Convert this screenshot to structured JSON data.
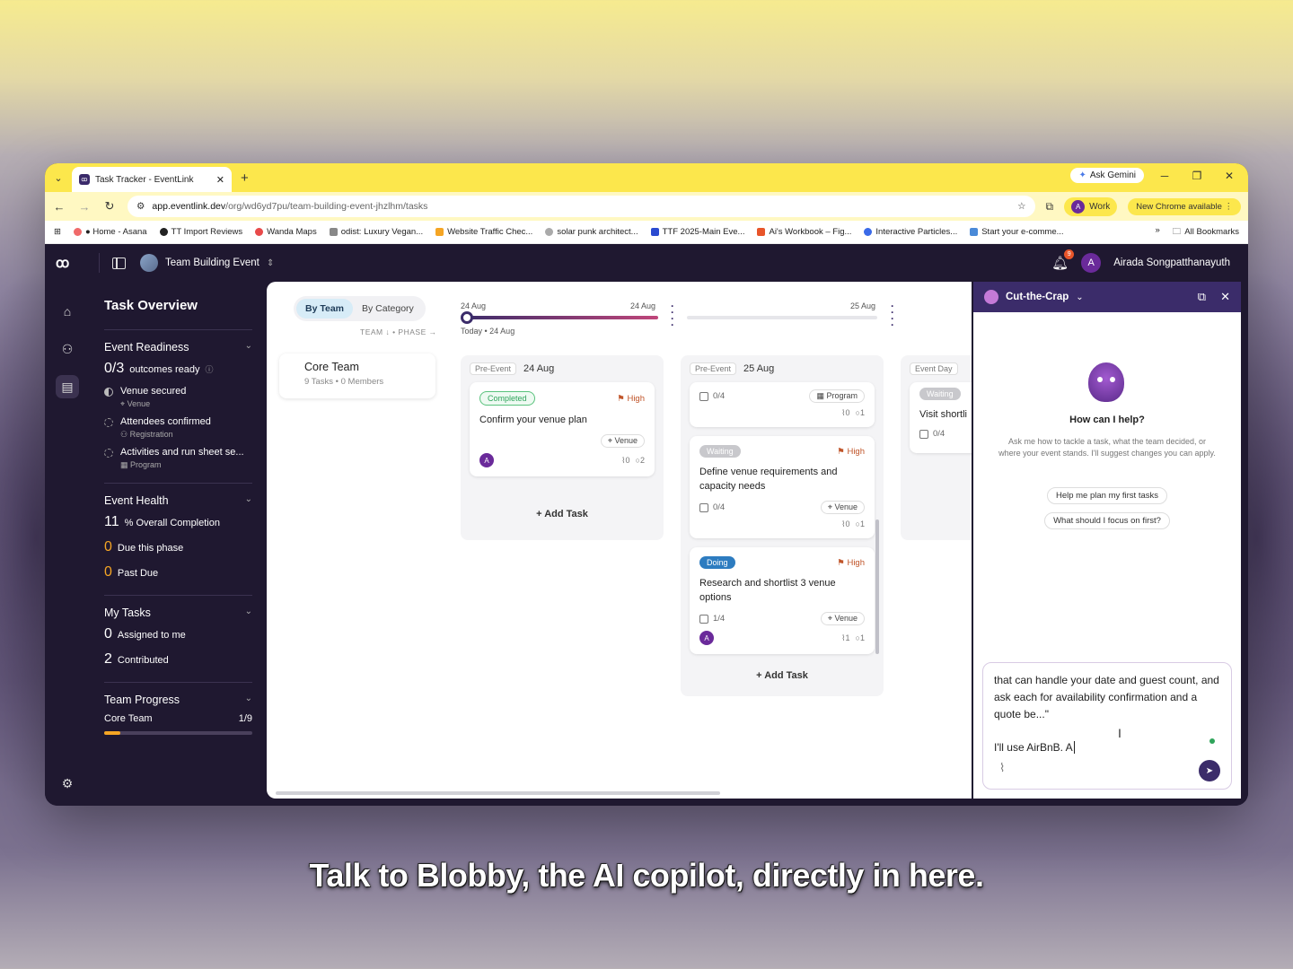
{
  "browser": {
    "tab_title": "Task Tracker - EventLink",
    "ask_gemini": "Ask Gemini",
    "url_host": "app.eventlink.dev",
    "url_path": "/org/wd6yd7pu/team-building-event-jhzlhm/tasks",
    "profile_label": "Work",
    "profile_initial": "A",
    "new_chrome": "New Chrome available",
    "bookmarks": [
      "● Home - Asana",
      "TT Import Reviews",
      "Wanda Maps",
      "odist: Luxury Vegan...",
      "Website Traffic Chec...",
      "solar punk architect...",
      "TTF 2025-Main Eve...",
      "Ai's Workbook – Fig...",
      "Interactive Particles...",
      "Start your e-comme..."
    ],
    "all_bookmarks": "All Bookmarks"
  },
  "app": {
    "project": "Team Building Event",
    "notification_count": "9",
    "user_initial": "A",
    "user_name": "Airada Songpatthanayuth"
  },
  "sidebar": {
    "title": "Task Overview",
    "readiness": {
      "heading": "Event Readiness",
      "count": "0/3",
      "count_label": "outcomes ready",
      "outcomes": [
        {
          "title": "Venue secured",
          "sub": "Venue"
        },
        {
          "title": "Attendees confirmed",
          "sub": "Registration"
        },
        {
          "title": "Activities and run sheet se...",
          "sub": "Program"
        }
      ]
    },
    "health": {
      "heading": "Event Health",
      "completion_value": "11",
      "completion_label": "% Overall Completion",
      "due_value": "0",
      "due_label": "Due this phase",
      "past_value": "0",
      "past_label": "Past Due"
    },
    "my_tasks": {
      "heading": "My Tasks",
      "assigned_value": "0",
      "assigned_label": "Assigned to me",
      "contributed_value": "2",
      "contributed_label": "Contributed"
    },
    "team_progress": {
      "heading": "Team Progress",
      "team": "Core Team",
      "value": "1/9",
      "fraction": 0.11
    }
  },
  "board": {
    "toggle": [
      "By Team",
      "By Category"
    ],
    "team_phase": "TEAM ↓ • PHASE →",
    "timeline": {
      "start": "24 Aug",
      "end": "24 Aug",
      "today": "Today • 24 Aug",
      "next": "25 Aug"
    },
    "team": {
      "name": "Core Team",
      "meta": "9 Tasks • 0 Members"
    },
    "columns": [
      {
        "phase": "Pre-Event",
        "date": "24 Aug",
        "add": "Add Task",
        "cards": [
          {
            "status": "Completed",
            "priority": "High",
            "title": "Confirm your venue plan",
            "tag": "Venue",
            "avatar": "A",
            "attachments": "0",
            "comments": "2"
          }
        ]
      },
      {
        "phase": "Pre-Event",
        "date": "25 Aug",
        "add": "Add Task",
        "cards": [
          {
            "checklist": "0/4",
            "tag": "Program",
            "attachments": "0",
            "comments": "1"
          },
          {
            "status": "Waiting",
            "priority": "High",
            "title": "Define venue requirements and capacity needs",
            "checklist": "0/4",
            "tag": "Venue",
            "attachments": "0",
            "comments": "1"
          },
          {
            "status": "Doing",
            "priority": "High",
            "title": "Research and shortlist 3 venue options",
            "checklist": "1/4",
            "tag": "Venue",
            "avatar": "A",
            "attachments": "1",
            "comments": "1"
          }
        ]
      },
      {
        "phase": "Event Day",
        "cards": [
          {
            "status": "Waiting",
            "title": "Visit shortli",
            "checklist": "0/4"
          }
        ]
      }
    ]
  },
  "chat": {
    "title": "Cut-the-Crap",
    "help_title": "How can I help?",
    "help_sub": "Ask me how to tackle a task, what the team decided, or where your event stands. I'll suggest changes you can apply.",
    "suggestions": [
      "Help me plan my first tasks",
      "What should I focus on first?"
    ],
    "input_line1": "that can handle your date and guest count, and ask each for availability confirmation and a quote be...\"",
    "input_line2": "I'll use AirBnB. A"
  },
  "caption": "Talk to Blobby, the AI copilot, directly in here."
}
